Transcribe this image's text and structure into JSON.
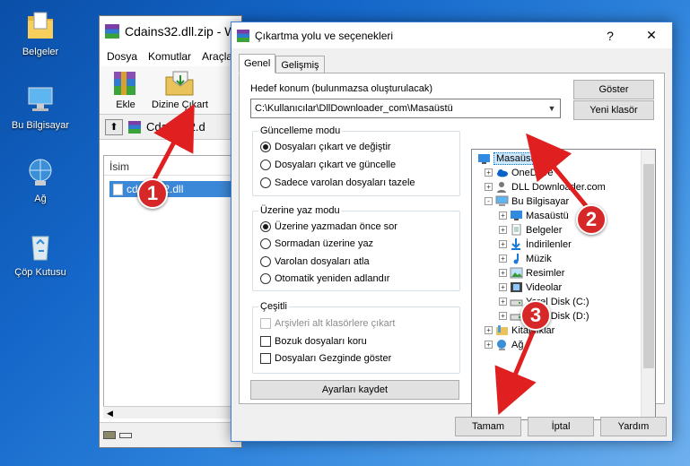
{
  "desktop": {
    "icons": [
      {
        "label": "Belgeler",
        "icon": "folder-icon"
      },
      {
        "label": "Bu Bilgisayar",
        "icon": "computer-icon"
      },
      {
        "label": "Ağ",
        "icon": "network-icon"
      },
      {
        "label": "Çöp Kutusu",
        "icon": "recycle-bin-icon"
      }
    ]
  },
  "winrar": {
    "title": "Cdains32.dll.zip - W",
    "menu": [
      "Dosya",
      "Komutlar",
      "Araçla"
    ],
    "tools": [
      {
        "label": "Ekle",
        "icon": "add-archive-icon"
      },
      {
        "label": "Dizine Çıkart",
        "icon": "extract-to-icon"
      }
    ],
    "address": "Cdains32.d",
    "column_name": "İsim",
    "file_name": "cdains32.dll"
  },
  "dialog": {
    "title": "Çıkartma yolu ve seçenekleri",
    "title_help": "?",
    "title_close": "✕",
    "tabs": [
      "Genel",
      "Gelişmiş"
    ],
    "dest_label": "Hedef konum (bulunmazsa oluşturulacak)",
    "dest_value": "C:\\Kullanıcılar\\DllDownloader_com\\Masaüstü",
    "show_button": "Göster",
    "new_folder_button": "Yeni klasör",
    "update_mode": {
      "title": "Güncelleme modu",
      "options": [
        "Dosyaları çıkart ve değiştir",
        "Dosyaları çıkart ve güncelle",
        "Sadece varolan dosyaları tazele"
      ],
      "selected": 0
    },
    "overwrite_mode": {
      "title": "Üzerine yaz modu",
      "options": [
        "Üzerine yazmadan önce sor",
        "Sormadan üzerine yaz",
        "Varolan dosyaları atla",
        "Otomatik yeniden adlandır"
      ],
      "selected": 0
    },
    "misc": {
      "title": "Çeşitli",
      "options": [
        {
          "label": "Arşivleri alt klasörlere çıkart",
          "checked": false,
          "disabled": true
        },
        {
          "label": "Bozuk dosyaları koru",
          "checked": false,
          "disabled": false
        },
        {
          "label": "Dosyaları Gezginde göster",
          "checked": false,
          "disabled": false
        }
      ]
    },
    "save_settings_button": "Ayarları kaydet",
    "tree": [
      {
        "label": "Masaüstü",
        "icon": "desktop-folder-icon",
        "expander": "",
        "selected": true
      },
      {
        "label": "OneDrive",
        "icon": "onedrive-icon",
        "expander": "+"
      },
      {
        "label": "DLL Downloader.com",
        "icon": "user-icon",
        "expander": "+"
      },
      {
        "label": "Bu Bilgisayar",
        "icon": "computer-icon",
        "expander": "-"
      },
      {
        "label": "Masaüstü",
        "icon": "desktop-folder-icon",
        "expander": "+"
      },
      {
        "label": "Belgeler",
        "icon": "documents-icon",
        "expander": "+"
      },
      {
        "label": "İndirilenler",
        "icon": "downloads-icon",
        "expander": "+"
      },
      {
        "label": "Müzik",
        "icon": "music-icon",
        "expander": "+"
      },
      {
        "label": "Resimler",
        "icon": "pictures-icon",
        "expander": "+"
      },
      {
        "label": "Videolar",
        "icon": "videos-icon",
        "expander": "+"
      },
      {
        "label": "Yerel Disk (C:)",
        "icon": "drive-icon",
        "expander": "+"
      },
      {
        "label": "Yerel Disk (D:)",
        "icon": "drive-icon",
        "expander": "+"
      },
      {
        "label": "Kitaplıklar",
        "icon": "library-icon",
        "expander": "+"
      },
      {
        "label": "Ağ",
        "icon": "network-icon",
        "expander": "+"
      }
    ],
    "ok_button": "Tamam",
    "cancel_button": "İptal",
    "help_button": "Yardım"
  },
  "markers": [
    "1",
    "2",
    "3"
  ],
  "colors": {
    "marker": "#d62828",
    "selection": "#3c88d8",
    "accent": "#0078d7"
  }
}
